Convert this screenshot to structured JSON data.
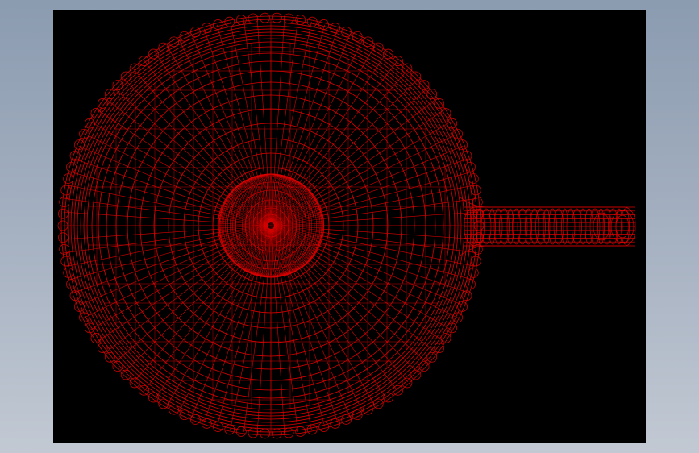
{
  "colors": {
    "background_top": "#8b9bb0",
    "background_bottom": "#c2c9d3",
    "viewport": "#000000",
    "wireframe": "#dd0000"
  },
  "model": {
    "shape": "round pan with handle",
    "render_mode": "wireframe"
  }
}
